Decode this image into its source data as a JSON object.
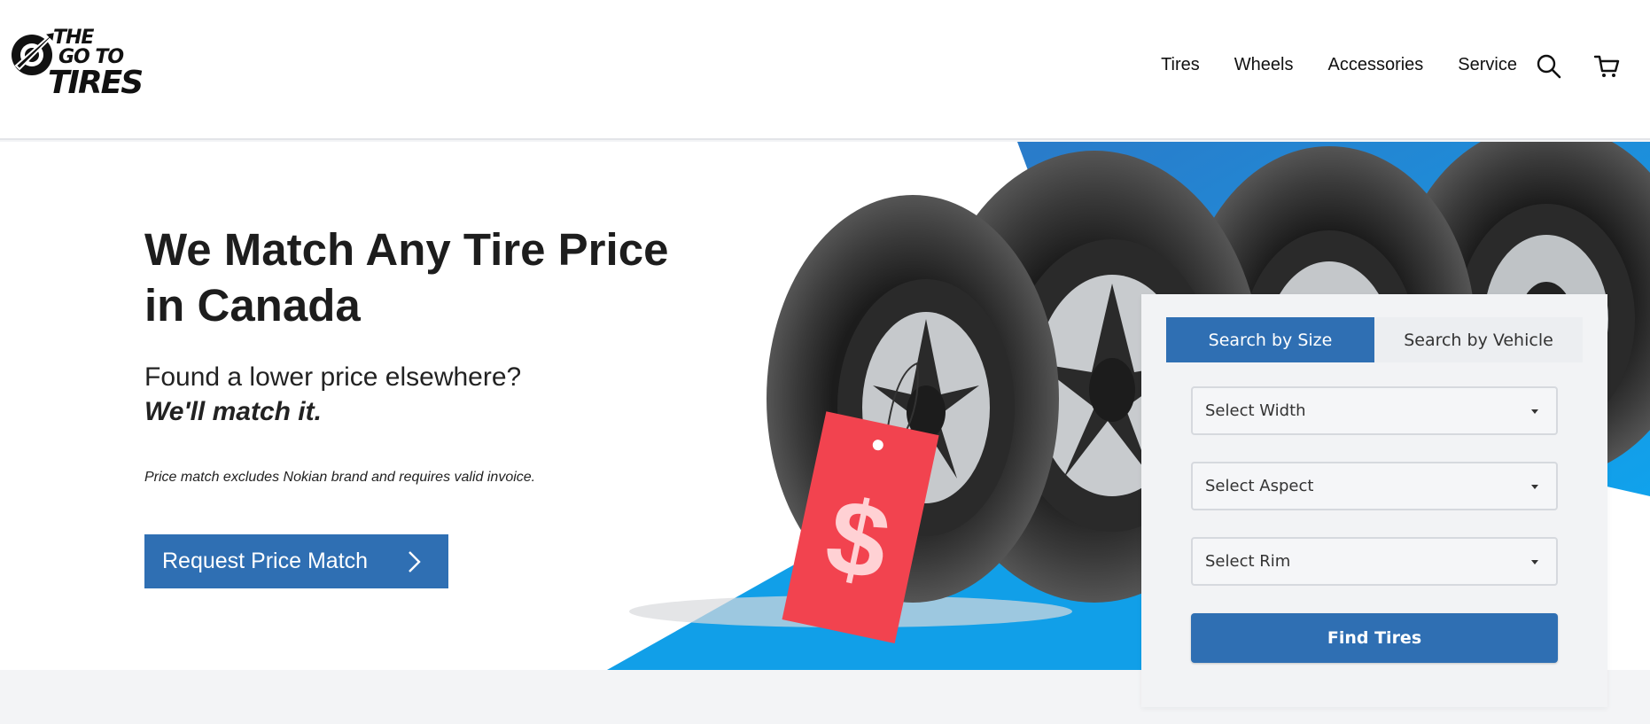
{
  "brand": {
    "line1": "THE",
    "line2": "GO TO",
    "line3": "TIRES"
  },
  "nav": {
    "tires": "Tires",
    "wheels": "Wheels",
    "accessories": "Accessories",
    "service": "Service"
  },
  "hero": {
    "headline": "We Match Any Tire Price in Canada",
    "subline": "Found a lower price elsewhere?",
    "subline_emphasis": "We'll match it.",
    "fineprint": "Price match excludes Nokian brand and requires valid invoice.",
    "cta_label": "Request Price Match",
    "price_tag_symbol": "$"
  },
  "search": {
    "tab_size": "Search by Size",
    "tab_vehicle": "Search by Vehicle",
    "width_placeholder": "Select Width",
    "aspect_placeholder": "Select Aspect",
    "rim_placeholder": "Select Rim",
    "find_label": "Find Tires"
  },
  "colors": {
    "brand_blue": "#2f6fb3",
    "accent_blue": "#1e8fe0",
    "tag_red": "#f2434f"
  }
}
